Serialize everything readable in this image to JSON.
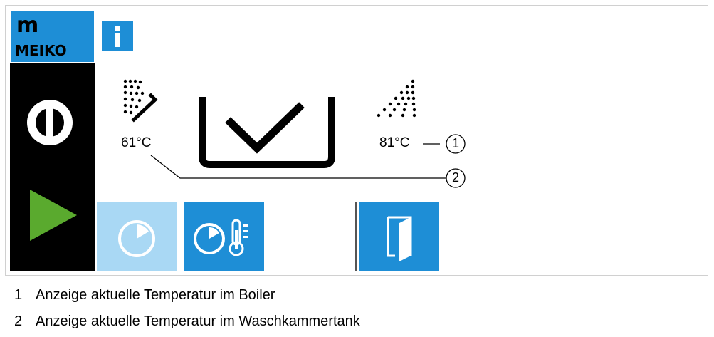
{
  "brand": {
    "mark": "m",
    "name": "MEIKO"
  },
  "info_label": "i",
  "display": {
    "wash_tank_temp": "61°C",
    "boiler_temp": "81°C"
  },
  "callouts": [
    {
      "number": "1"
    },
    {
      "number": "2"
    }
  ],
  "legend": [
    {
      "number": "1",
      "text": "Anzeige aktuelle Temperatur im Boiler"
    },
    {
      "number": "2",
      "text": "Anzeige aktuelle Temperatur im Waschkammertank"
    }
  ],
  "colors": {
    "accent_blue": "#1e8ed6",
    "light_blue": "#a9d8f4",
    "start_green": "#5aaa2e",
    "sidebar": "#000000"
  },
  "icons": {
    "power": "power-icon",
    "start": "play-icon",
    "timer": "timer-icon",
    "timer_temp": "timer-thermometer-icon",
    "door": "door-icon",
    "wash_spray": "wash-spray-icon",
    "rinse_spray": "rinse-spray-icon",
    "basket": "basket-check-icon"
  }
}
